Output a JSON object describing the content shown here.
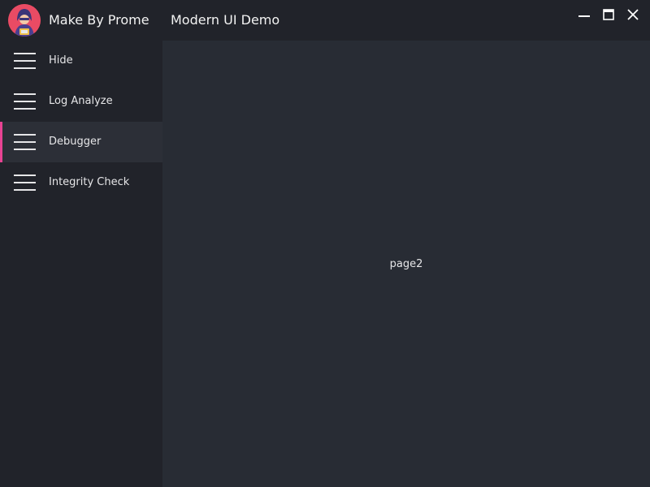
{
  "titlebar": {
    "app_name": "Make By Prome",
    "window_title": "Modern UI Demo",
    "avatar_icon": "user-avatar-icon",
    "controls": {
      "minimize_icon": "minimize-icon",
      "maximize_icon": "maximize-icon",
      "close_icon": "close-icon"
    }
  },
  "sidebar": {
    "items": [
      {
        "label": "Hide",
        "icon": "hamburger-menu-icon",
        "active": false
      },
      {
        "label": "Log Analyze",
        "icon": "hamburger-menu-icon",
        "active": false
      },
      {
        "label": "Debugger",
        "icon": "hamburger-menu-icon",
        "active": true
      },
      {
        "label": "Integrity Check",
        "icon": "hamburger-menu-icon",
        "active": false
      }
    ]
  },
  "content": {
    "page_text": "page2"
  },
  "colors": {
    "background": "#282c34",
    "sidebar": "#21232a",
    "active_item": "#2c2f37",
    "accent": "#e84393",
    "avatar": "#e94b64",
    "text": "#e6e6e8"
  }
}
